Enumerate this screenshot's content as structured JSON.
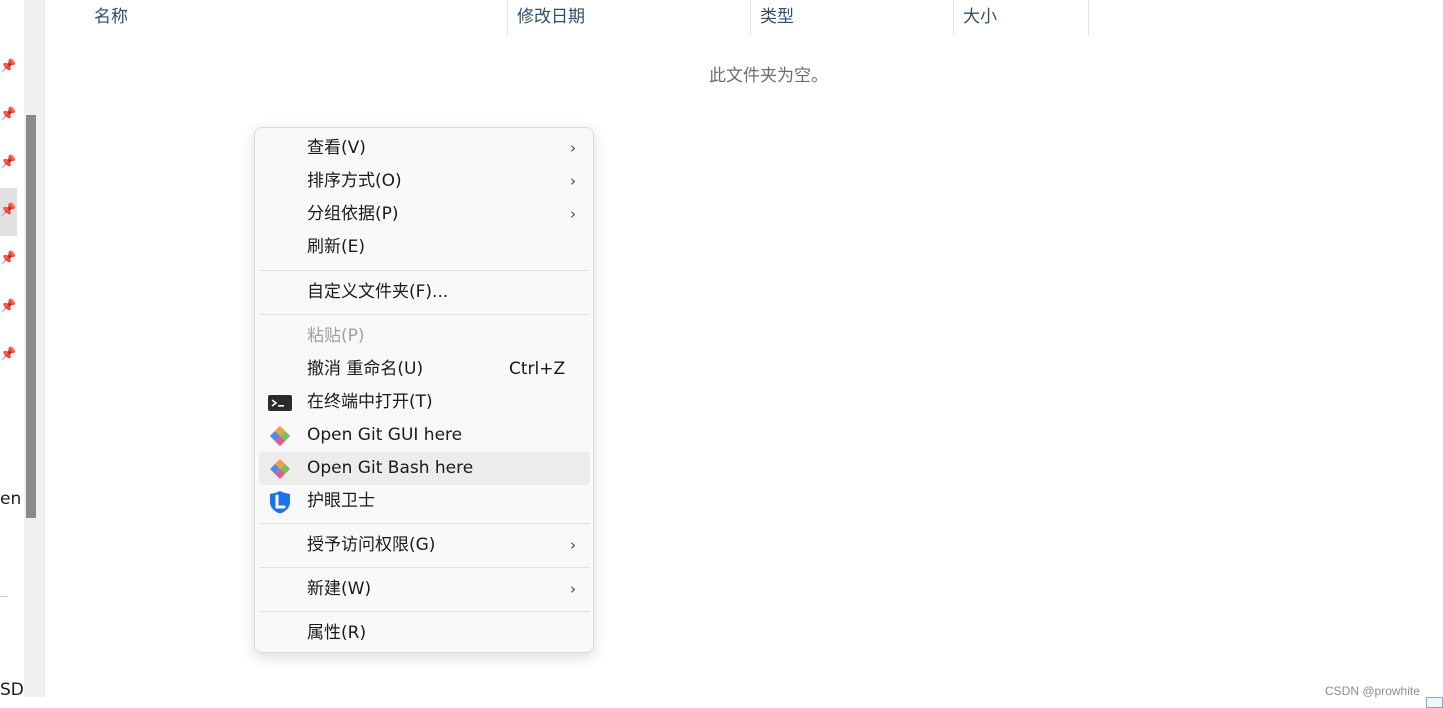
{
  "nav": {
    "cut_text_1": "en",
    "cut_text_2": "SD"
  },
  "columns": {
    "name": "名称",
    "modified": "修改日期",
    "type": "类型",
    "size": "大小"
  },
  "sort_indicator": "^",
  "empty_message": "此文件夹为空。",
  "context_menu": {
    "view": "查看(V)",
    "sort_by": "排序方式(O)",
    "group_by": "分组依据(P)",
    "refresh": "刷新(E)",
    "customize_folder": "自定义文件夹(F)...",
    "paste": "粘贴(P)",
    "undo_rename": "撤消 重命名(U)",
    "undo_shortcut": "Ctrl+Z",
    "open_terminal": "在终端中打开(T)",
    "git_gui": "Open Git GUI here",
    "git_bash": "Open Git Bash here",
    "eye_guard": "护眼卫士",
    "grant_access": "授予访问权限(G)",
    "new": "新建(W)",
    "properties": "属性(R)"
  },
  "watermark": "CSDN @prowhite",
  "icons": {
    "submenu": "chevron-right-icon",
    "terminal": "terminal-icon",
    "git": "git-icon",
    "shield": "eye-guard-shield-icon",
    "pin": "pin-icon"
  },
  "colors": {
    "menu_bg": "#f9f9f9",
    "hover_bg": "#ececec",
    "header_text": "#334d66",
    "shield_blue": "#1a73e8"
  }
}
